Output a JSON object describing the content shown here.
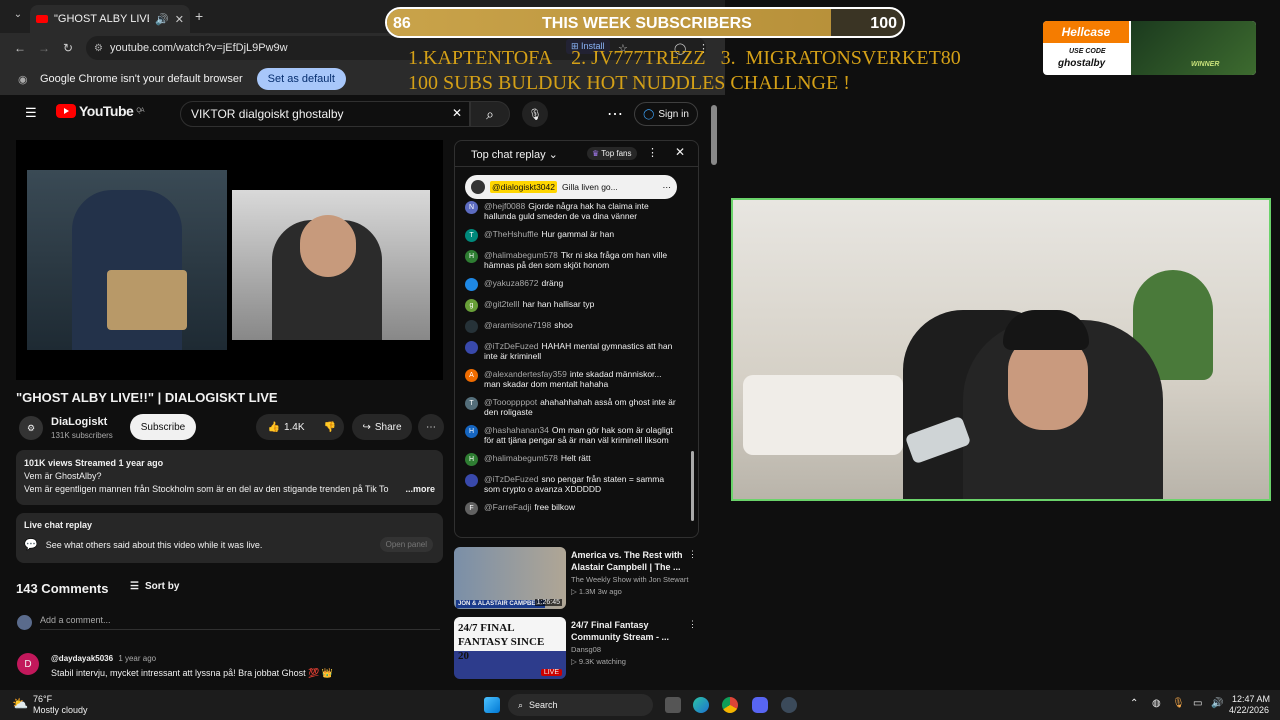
{
  "browser": {
    "tab_title": "\"GHOST ALBY LIVE!!\" | DIAL",
    "url": "youtube.com/watch?v=jEfDjL9Pw9w",
    "install_label": "Install",
    "infobar_text": "Google Chrome isn't your default browser",
    "set_default_label": "Set as default"
  },
  "youtube": {
    "logo_text": "YouTube",
    "country": "QA",
    "search_value": "VIKTOR dialgoiskt ghostalby",
    "signin_label": "Sign in",
    "video_title": "\"GHOST ALBY LIVE!!\" | DIALOGISKT LIVE",
    "channel_name": "DiaLogiskt",
    "channel_subs": "131K subscribers",
    "subscribe_label": "Subscribe",
    "likes": "1.4K",
    "share_label": "Share",
    "desc_stats": "101K views  Streamed 1 year ago",
    "desc_line1": "Vem är GhostAlby?",
    "desc_line2": "Vem är egentligen mannen från Stockholm som är en del av den stigande trenden på Tik To",
    "more_label": "...more",
    "live_chat_title": "Live chat replay",
    "live_chat_text": "See what others said about this video while it was live.",
    "open_panel_label": "Open panel",
    "comments_count": "143 Comments",
    "sort_label": "Sort by",
    "add_comment_placeholder": "Add a comment...",
    "comment": {
      "author": "@daydayak5036",
      "time": "1 year ago",
      "text": "Stabil intervju, mycket intressant att lyssna på! Bra jobbat Ghost 💯 👑"
    }
  },
  "chat": {
    "header": "Top chat replay",
    "top_fans": "Top fans",
    "pinned_author": "@dialogiskt3042",
    "pinned_text": "Gilla liven go...",
    "messages": [
      {
        "author": "@hejf0088",
        "text": "Gjorde några hak ha claima inte hallunda guld smeden de va dina vänner",
        "color": "#5c6bc0",
        "initial": "N"
      },
      {
        "author": "@TheHshuffle",
        "text": "Hur gammal är han",
        "color": "#00897b",
        "initial": "T"
      },
      {
        "author": "@halimabegum578",
        "text": "Tkr ni ska fråga om han ville hämnas på den som skjöt honom",
        "color": "#2e7d32",
        "initial": "H"
      },
      {
        "author": "@yakuza8672",
        "text": "dräng",
        "color": "#1e88e5",
        "initial": ""
      },
      {
        "author": "@git2tellI",
        "text": "har han hallisar typ",
        "color": "#689f38",
        "initial": "g"
      },
      {
        "author": "@aramisone7198",
        "text": "shoo",
        "color": "#263238",
        "initial": ""
      },
      {
        "author": "@iTzDeFuzed",
        "text": "HAHAH mental gymnastics att han inte är kriminell",
        "color": "#3949ab",
        "initial": ""
      },
      {
        "author": "@alexandertesfay359",
        "text": "inte skadad människor... man skadar dom mentalt hahaha",
        "color": "#ef6c00",
        "initial": "A"
      },
      {
        "author": "@Toooppppot",
        "text": "ahahahhahah asså om ghost inte är den roligaste",
        "color": "#546e7a",
        "initial": "T"
      },
      {
        "author": "@hashahanan34",
        "text": "Om man gör hak som är olagligt för att tjäna pengar så är man väl kriminell liksom",
        "color": "#1565c0",
        "initial": "H"
      },
      {
        "author": "@halimabegum578",
        "text": "Helt rätt",
        "color": "#2e7d32",
        "initial": "H"
      },
      {
        "author": "@iTzDeFuzed",
        "text": "sno pengar från staten = samma som crypto o avanza XDDDDD",
        "color": "#3949ab",
        "initial": ""
      },
      {
        "author": "@FarreFadji",
        "text": "free bilkow",
        "color": "#616161",
        "initial": "F"
      }
    ]
  },
  "recommendations": [
    {
      "title": "America vs. The Rest with Alastair Campbell | The ...",
      "channel": "The Weekly Show with Jon Stewart",
      "meta": "▷ 1.3M  3w ago",
      "duration": "1:26:45",
      "thumb_text": "JON & ALASTAIR CAMPBELL"
    },
    {
      "title": "24/7 Final Fantasy Community Stream - ...",
      "channel": "Dansg08",
      "meta": "▷ 9.3K watching",
      "duration": "LIVE",
      "thumb_text": "24/7 FINAL FANTASY SINCE 20"
    }
  ],
  "overlay": {
    "subs_current": "86",
    "subs_title": "THIS WEEK SUBSCRIBERS",
    "subs_goal": "100",
    "subs_progress": 0.86,
    "leaders_line1": "1.KAPTENTOFA    2. JV777TREZZ   3.  MIGRATONSVERKET80",
    "leaders_line2": "100 SUBS BULDUK HOT NUDDLES CHALLNGE !",
    "hellcase_brand": "Hellcase",
    "use_code_label": "USE CODE",
    "use_code": "ghostalby",
    "winner_label": "WINNER"
  },
  "taskbar": {
    "weather_temp": "76°F",
    "weather_desc": "Mostly cloudy",
    "search_label": "Search",
    "time": "12:47 AM",
    "date": "4/22/2026"
  }
}
